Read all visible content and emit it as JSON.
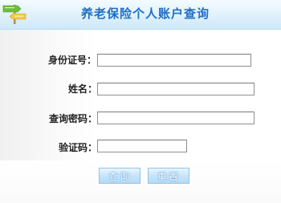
{
  "header": {
    "title": "养老保险个人账户查询"
  },
  "form": {
    "id_number": {
      "label": "身份证号：",
      "value": ""
    },
    "name": {
      "label": "姓名：",
      "value": ""
    },
    "password": {
      "label": "查询密码：",
      "value": ""
    },
    "captcha": {
      "label": "验证码：",
      "value": ""
    }
  },
  "buttons": {
    "query": "查询",
    "reset": "重置"
  },
  "colors": {
    "title": "#1f6fc5",
    "header_bg": "#dff1fc",
    "button_bg": "#c6e4fa"
  }
}
